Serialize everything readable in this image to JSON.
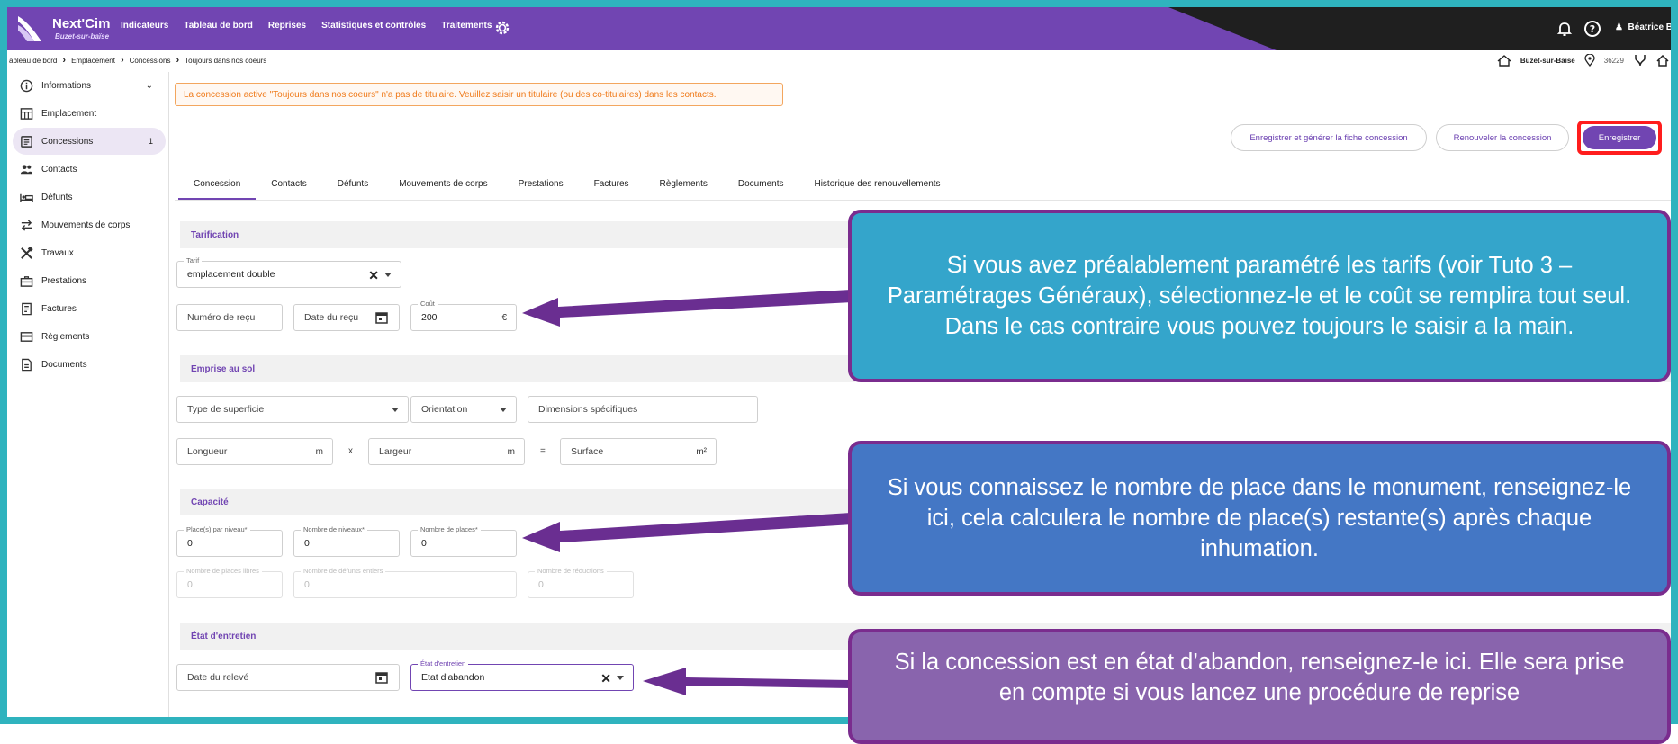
{
  "header": {
    "brand": "Next'Cim",
    "brand_sub": "Buzet-sur-baïse",
    "nav": [
      "Indicateurs",
      "Tableau de bord",
      "Reprises",
      "Statistiques et contrôles",
      "Traitements"
    ],
    "user": "Béatrice B."
  },
  "breadcrumb": {
    "items": [
      "ableau de bord",
      "Emplacement",
      "Concessions",
      "Toujours dans nos coeurs"
    ],
    "location": "Buzet-sur-Baïse",
    "code": "36229"
  },
  "sidebar": {
    "items": [
      {
        "label": "Informations",
        "icon": "info-icon"
      },
      {
        "label": "Emplacement",
        "icon": "grid-icon"
      },
      {
        "label": "Concessions",
        "icon": "document-list-icon",
        "count": "1"
      },
      {
        "label": "Contacts",
        "icon": "people-icon"
      },
      {
        "label": "Défunts",
        "icon": "bed-icon"
      },
      {
        "label": "Mouvements de corps",
        "icon": "swap-arrows-icon"
      },
      {
        "label": "Travaux",
        "icon": "tools-icon"
      },
      {
        "label": "Prestations",
        "icon": "briefcase-icon"
      },
      {
        "label": "Factures",
        "icon": "receipt-icon"
      },
      {
        "label": "Règlements",
        "icon": "card-icon"
      },
      {
        "label": "Documents",
        "icon": "file-icon"
      }
    ]
  },
  "alert": "La concession active \"Toujours dans nos coeurs\" n'a pas de titulaire. Veuillez saisir un titulaire (ou des co-titulaires) dans les contacts.",
  "actions": {
    "generate": "Enregistrer et générer la fiche concession",
    "renew": "Renouveler la concession",
    "save": "Enregistrer"
  },
  "tabs": [
    "Concession",
    "Contacts",
    "Défunts",
    "Mouvements de corps",
    "Prestations",
    "Factures",
    "Règlements",
    "Documents",
    "Historique des renouvellements"
  ],
  "tarification": {
    "title": "Tarification",
    "tarif_label": "Tarif",
    "tarif_value": "emplacement double",
    "receipt_number": "Numéro de reçu",
    "receipt_date": "Date du reçu",
    "cost_label": "Coût",
    "cost_value": "200",
    "currency": "€"
  },
  "emprise": {
    "title": "Emprise au sol",
    "surface_type": "Type de superficie",
    "orientation": "Orientation",
    "dimensions": "Dimensions spécifiques",
    "length": "Longueur",
    "width": "Largeur",
    "surface": "Surface",
    "unit_m": "m",
    "unit_m2": "m²",
    "times": "x",
    "equals": "="
  },
  "capacite": {
    "title": "Capacité",
    "per_level_label": "Place(s) par niveau*",
    "per_level": "0",
    "levels_label": "Nombre de niveaux*",
    "levels": "0",
    "places_label": "Nombre de places*",
    "places": "0",
    "free_label": "Nombre de places libres",
    "free": "0",
    "deceased_label": "Nombre de défunts entiers",
    "deceased": "0",
    "reductions_label": "Nombre de réductions",
    "reductions": "0"
  },
  "entretien": {
    "title": "État d'entretien",
    "date_label": "Date du relevé",
    "state_label": "État d'entretien",
    "state_value": "Etat d'abandon"
  },
  "callouts": {
    "c1": "Si vous avez préalablement paramétré les tarifs (voir Tuto 3 – Paramétrages Généraux), sélectionnez-le et le coût se remplira tout seul. Dans le cas contraire vous pouvez toujours le saisir a la main.",
    "c2": "Si vous connaissez le nombre de place dans le monument, renseignez-le ici, cela calculera le nombre de place(s) restante(s) après chaque inhumation.",
    "c3": "Si la concession est en état d’abandon, renseignez-le ici. Elle sera prise en compte si vous lancez une procédure de reprise"
  },
  "colors": {
    "brand": "#7145b2",
    "frame": "#2fb3be",
    "alert": "#ef7a1a",
    "highlight": "#ff1d1d",
    "callout1": "#34a5cb",
    "callout2": "#4477c5",
    "callout3": "#8964ad",
    "arrow": "#6a2e91"
  }
}
